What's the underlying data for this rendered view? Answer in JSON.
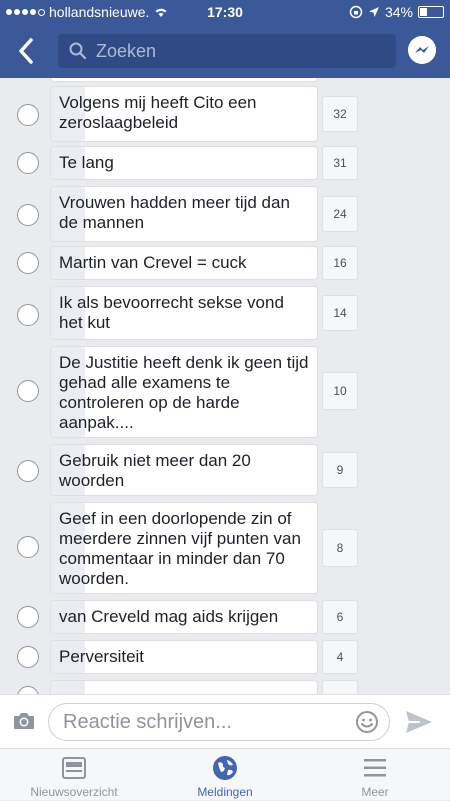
{
  "status_bar": {
    "carrier": "hollandsnieuwe.",
    "time": "17:30",
    "battery": "34%"
  },
  "nav": {
    "search_placeholder": "Zoeken"
  },
  "poll_options": [
    {
      "text": "Volgens mij heeft Cito een zeroslaagbeleid",
      "count": "32"
    },
    {
      "text": "Te lang",
      "count": "31"
    },
    {
      "text": "Vrouwen hadden meer tijd dan de mannen",
      "count": "24"
    },
    {
      "text": "Martin van Crevel = cuck",
      "count": "16"
    },
    {
      "text": "Ik als bevoorrecht sekse vond het kut",
      "count": "14"
    },
    {
      "text": "De Justitie heeft denk ik geen tijd gehad alle examens te controleren op de harde aanpak....",
      "count": "10"
    },
    {
      "text": "Gebruik niet meer dan 20 woorden",
      "count": "9"
    },
    {
      "text": "Geef in een doorlopende zin of meerdere zinnen vijf punten van commentaar in minder dan 70 woorden.",
      "count": "8"
    },
    {
      "text": "van Creveld mag aids krijgen",
      "count": "6"
    },
    {
      "text": "Perversiteit",
      "count": "4"
    }
  ],
  "composer": {
    "placeholder": "Reactie schrijven..."
  },
  "tabs": [
    {
      "label": "Nieuwsoverzicht",
      "icon": "news-feed-icon"
    },
    {
      "label": "Meldingen",
      "icon": "globe-icon",
      "active": true
    },
    {
      "label": "Meer",
      "icon": "menu-icon"
    }
  ],
  "colors": {
    "brand": "#3b5998",
    "active_tab": "#4267b2"
  }
}
